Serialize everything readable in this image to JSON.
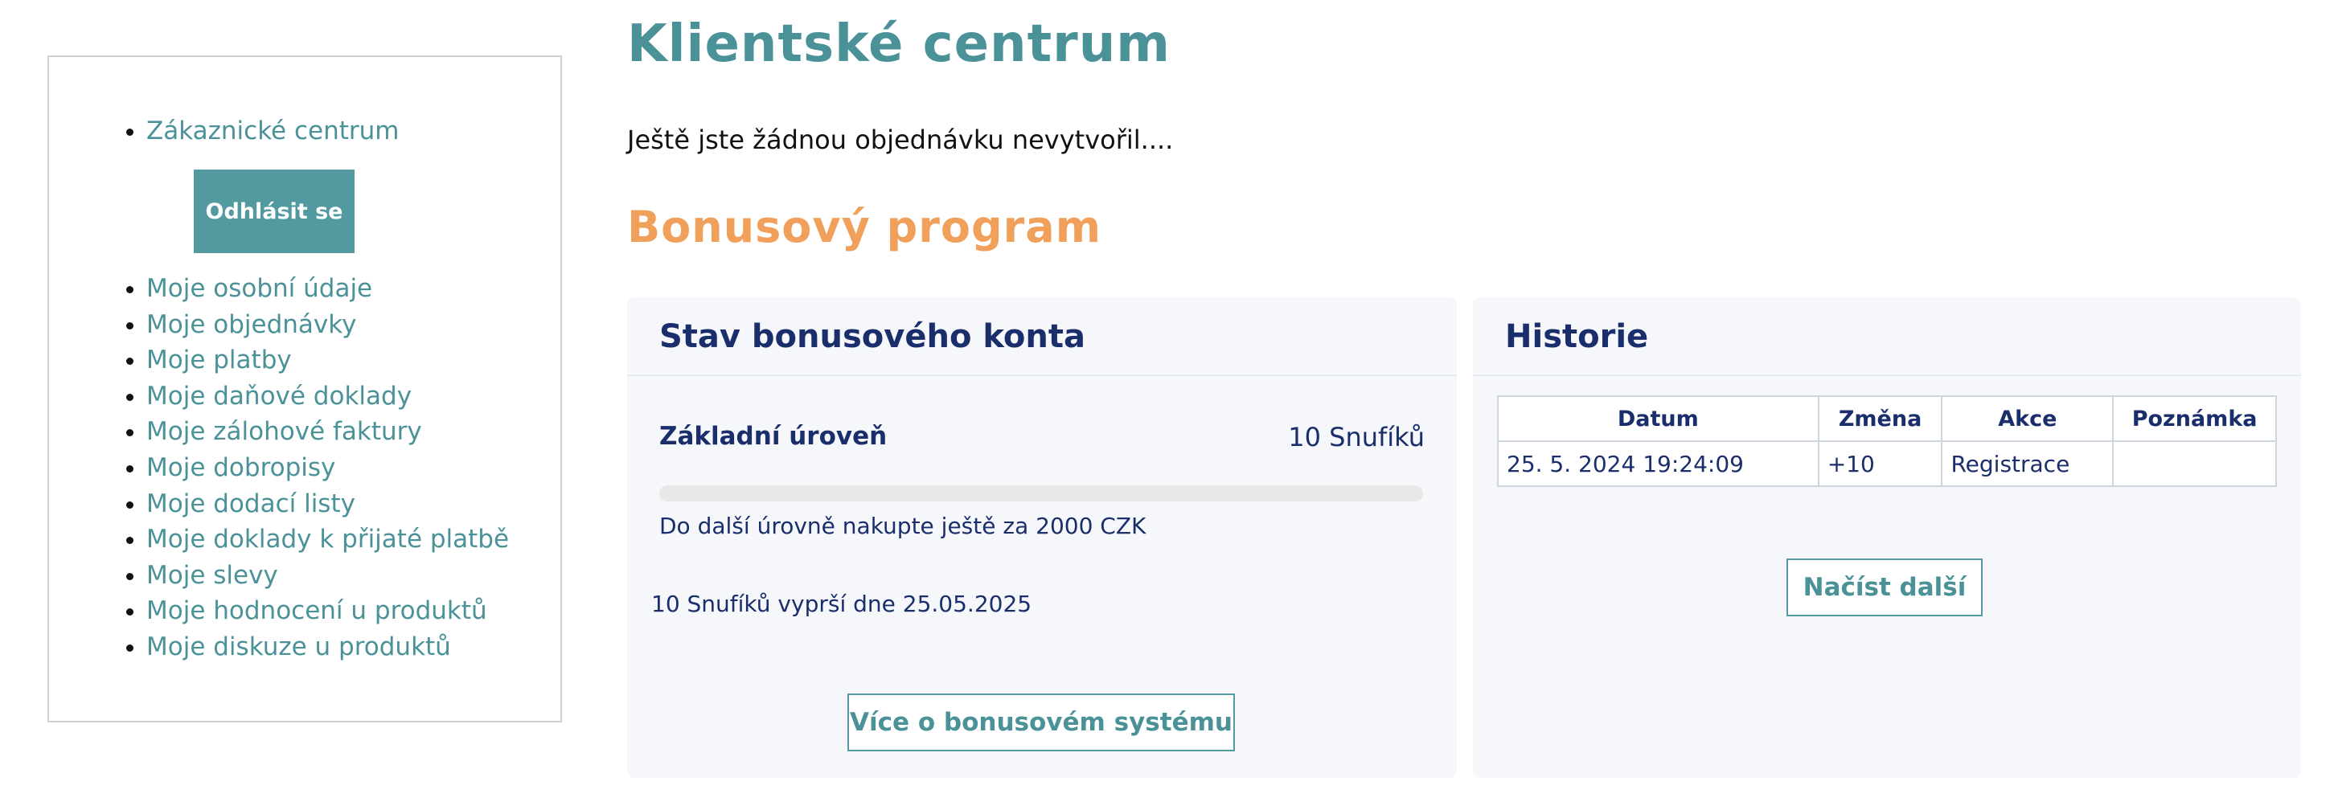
{
  "sidebar": {
    "items": [
      {
        "label": "Zákaznické centrum"
      },
      {
        "label": "Moje osobní údaje"
      },
      {
        "label": "Moje objednávky"
      },
      {
        "label": "Moje platby"
      },
      {
        "label": "Moje daňové doklady"
      },
      {
        "label": "Moje zálohové faktury"
      },
      {
        "label": "Moje dobropisy"
      },
      {
        "label": "Moje dodací listy"
      },
      {
        "label": "Moje doklady k přijaté platbě"
      },
      {
        "label": "Moje slevy"
      },
      {
        "label": "Moje hodnocení u produktů"
      },
      {
        "label": "Moje diskuze u produktů"
      }
    ],
    "logout_label": "Odhlásit se"
  },
  "main": {
    "title": "Klientské centrum",
    "no_orders_text": "Ještě jste žádnou objednávku nevytvořil....",
    "bonus_title": "Bonusový program"
  },
  "bonus_card": {
    "title": "Stav bonusového konta",
    "level_label": "Základní úroveň",
    "level_value": "10 Snufíků",
    "progress_fraction": 0,
    "next_level_text": "Do další úrovně nakupte ještě za 2000 CZK",
    "expiry_text": "10 Snufíků vyprší dne 25.05.2025",
    "more_button": "Více o bonusovém systému"
  },
  "history_card": {
    "title": "Historie",
    "columns": [
      "Datum",
      "Změna",
      "Akce",
      "Poznámka"
    ],
    "rows": [
      [
        "25. 5. 2024 19:24:09",
        "+10",
        "Registrace",
        ""
      ]
    ],
    "load_more_button": "Načíst další"
  },
  "colors": {
    "accent": "#539aa0",
    "link": "#4a9298",
    "bonus_title": "#f0a05a",
    "navy": "#1a2e6c",
    "card_bg": "#f5f7fb"
  }
}
